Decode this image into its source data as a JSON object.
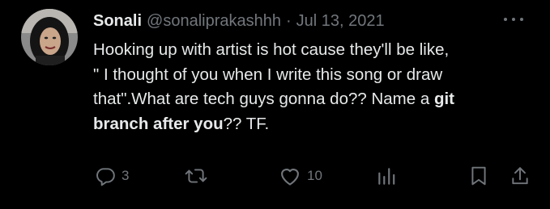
{
  "tweet": {
    "display_name": "Sonali",
    "handle": "@sonaliprakashhh",
    "separator": "·",
    "timestamp": "Jul 13, 2021",
    "text_line1": "Hooking up with artist is hot cause they'll be like,",
    "text_line2": "\" I thought of you when I write this song or draw",
    "text_line3a": "that\".What are tech guys gonna do?? Name a ",
    "text_line3b": "git",
    "text_line4a": "branch after you",
    "text_line4b": "?? TF.",
    "replies": "3",
    "likes": "10"
  },
  "icons": {
    "reply": "reply-icon",
    "retweet": "retweet-icon",
    "like": "heart-icon",
    "views": "views-icon",
    "bookmark": "bookmark-icon",
    "share": "share-icon",
    "more": "more-icon"
  },
  "colors": {
    "background": "#000000",
    "text": "#e7e9ea",
    "muted": "#71767b"
  }
}
